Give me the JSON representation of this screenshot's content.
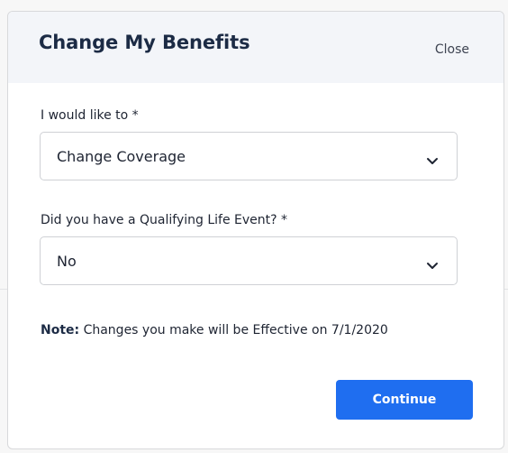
{
  "modal": {
    "title": "Change My Benefits",
    "close_label": "Close"
  },
  "form": {
    "action_field": {
      "label": "I would like to *",
      "selected": "Change Coverage"
    },
    "life_event_field": {
      "label": "Did you have a Qualifying Life Event? *",
      "selected": "No"
    },
    "note": {
      "prefix": "Note:",
      "text": " Changes you make will be Effective on 7/1/2020"
    },
    "continue_label": "Continue"
  },
  "colors": {
    "primary": "#1f6ef0",
    "title": "#1c2b45",
    "header_bg": "#f3f5f9"
  },
  "icons": {
    "dropdown": "chevron-down-icon"
  }
}
